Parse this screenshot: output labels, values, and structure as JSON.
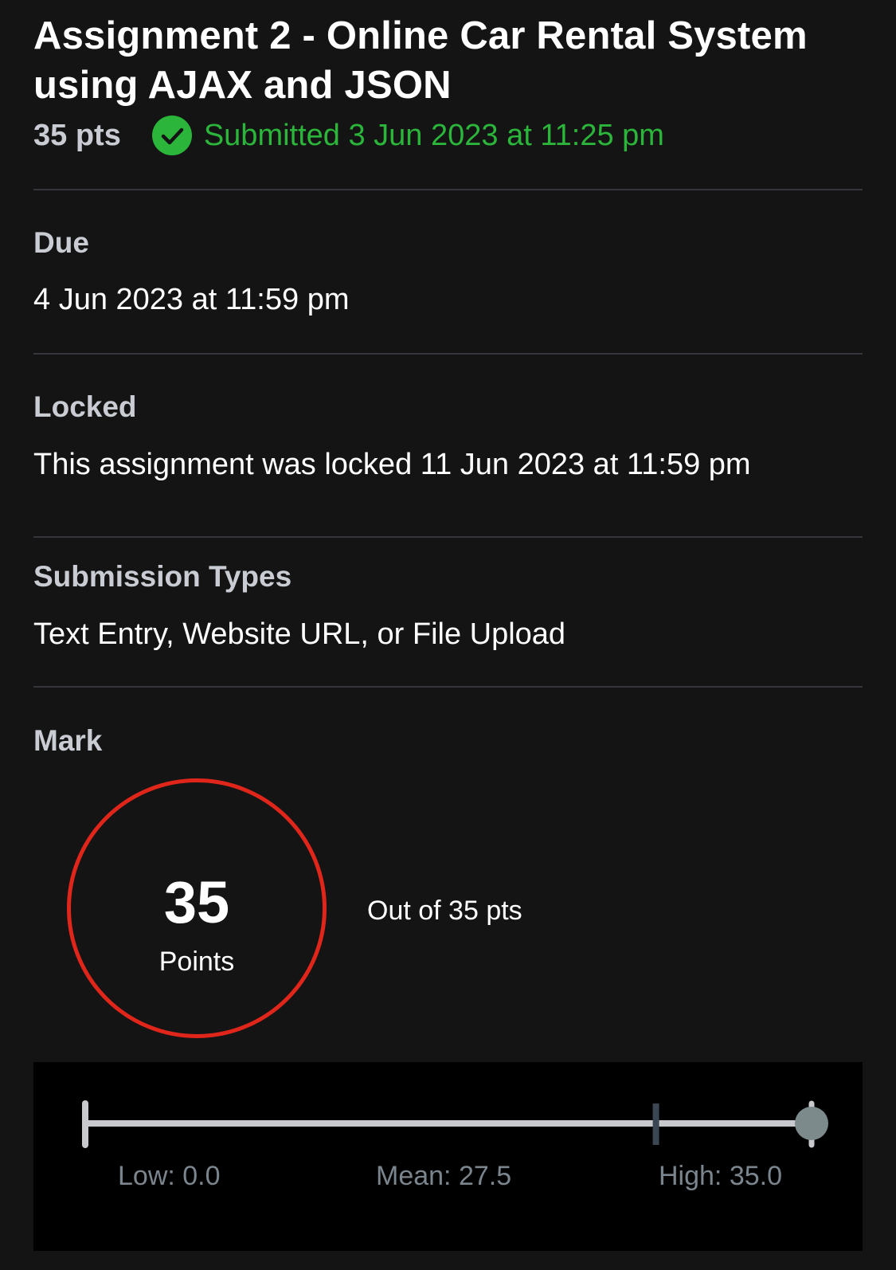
{
  "assignment": {
    "title": "Assignment 2 - Online Car Rental System using AJAX and JSON",
    "points": "35 pts",
    "submitted": "Submitted 3 Jun 2023 at 11:25 pm"
  },
  "sections": {
    "due": {
      "label": "Due",
      "value": "4 Jun 2023 at 11:59 pm"
    },
    "locked": {
      "label": "Locked",
      "value": "This assignment was locked 11 Jun 2023 at 11:59 pm"
    },
    "submission_types": {
      "label": "Submission Types",
      "value": "Text Entry, Website URL, or File Upload"
    },
    "mark": {
      "label": "Mark",
      "score": "35",
      "unit": "Points",
      "out_of": "Out of 35 pts"
    }
  },
  "stats": {
    "low_label": "Low: 0.0",
    "mean_label": "Mean: 27.5",
    "high_label": "High: 35.0",
    "low": 0.0,
    "mean": 27.5,
    "high": 35.0,
    "score": 35,
    "max": 35
  },
  "colors": {
    "submitted": "#2bb53b",
    "mark_ring": "#e0261a",
    "track": "#c7c9cc",
    "mean_tick": "#3a4651",
    "score_dot": "#7d8a8c"
  },
  "icons": {
    "submitted": "check-circle-icon"
  }
}
